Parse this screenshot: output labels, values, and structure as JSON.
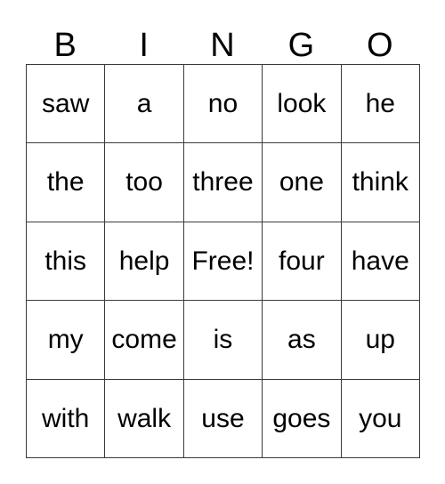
{
  "card": {
    "title": "BINGO",
    "headers": [
      "B",
      "I",
      "N",
      "G",
      "O"
    ],
    "rows": [
      [
        "saw",
        "a",
        "no",
        "look",
        "he"
      ],
      [
        "the",
        "too",
        "three",
        "one",
        "think"
      ],
      [
        "this",
        "help",
        "Free!",
        "four",
        "have"
      ],
      [
        "my",
        "come",
        "is",
        "as",
        "up"
      ],
      [
        "with",
        "walk",
        "use",
        "goes",
        "you"
      ]
    ],
    "free_space": {
      "label": "Free!",
      "row": 2,
      "column": 2
    },
    "colors": {
      "background": "#ffffff",
      "text": "#000000",
      "border": "#3a3a3a"
    }
  }
}
